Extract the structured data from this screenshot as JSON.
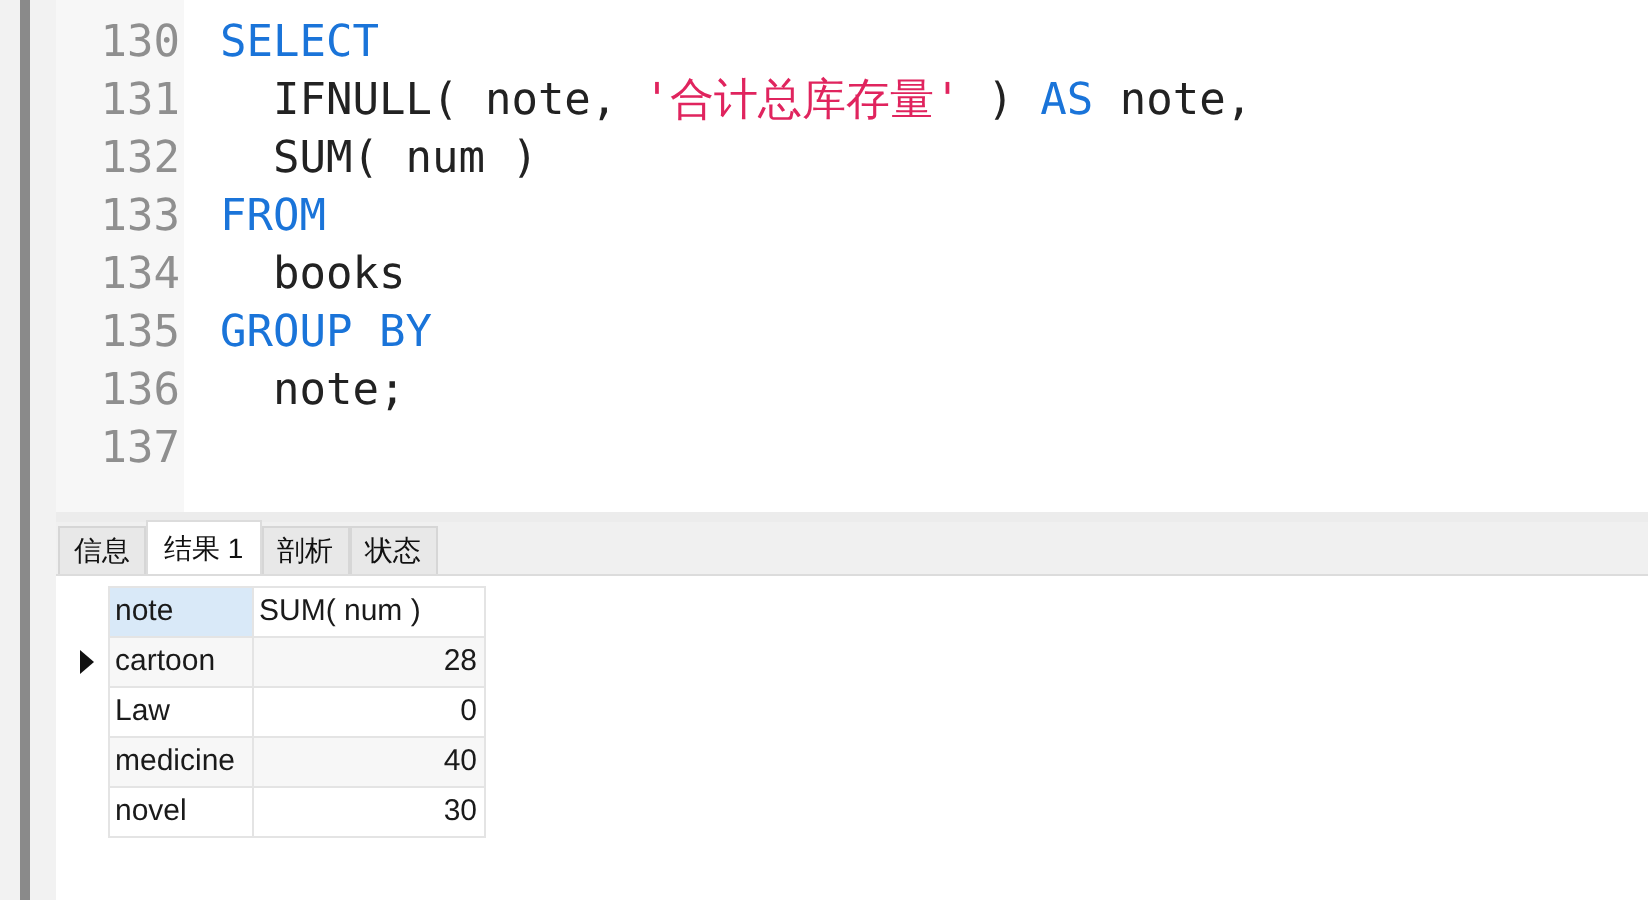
{
  "editor": {
    "lines": [
      {
        "number": "130",
        "tokens": [
          {
            "kind": "keyword",
            "text": "SELECT"
          }
        ]
      },
      {
        "number": "131",
        "tokens": [
          {
            "kind": "plain",
            "text": "  IFNULL( note, "
          },
          {
            "kind": "string",
            "text": "'合计总库存量'"
          },
          {
            "kind": "plain",
            "text": " ) "
          },
          {
            "kind": "keyword",
            "text": "AS"
          },
          {
            "kind": "plain",
            "text": " note,"
          }
        ]
      },
      {
        "number": "132",
        "tokens": [
          {
            "kind": "plain",
            "text": "  SUM( num )"
          }
        ]
      },
      {
        "number": "133",
        "tokens": [
          {
            "kind": "keyword",
            "text": "FROM"
          }
        ]
      },
      {
        "number": "134",
        "tokens": [
          {
            "kind": "plain",
            "text": "  books"
          }
        ]
      },
      {
        "number": "135",
        "tokens": [
          {
            "kind": "keyword",
            "text": "GROUP BY"
          }
        ]
      },
      {
        "number": "136",
        "tokens": [
          {
            "kind": "plain",
            "text": "  note;"
          }
        ]
      },
      {
        "number": "137"
      }
    ]
  },
  "result_tabs": [
    {
      "label": "信息",
      "selected": false
    },
    {
      "label": "结果 1",
      "selected": true
    },
    {
      "label": "剖析",
      "selected": false
    },
    {
      "label": "状态",
      "selected": false
    }
  ],
  "table": {
    "columns": [
      "note",
      "SUM( num )"
    ],
    "rows": [
      {
        "cells": [
          "cartoon",
          "28"
        ],
        "current": true
      },
      {
        "cells": [
          "Law",
          "0"
        ],
        "current": false
      },
      {
        "cells": [
          "medicine",
          "40"
        ],
        "current": false
      },
      {
        "cells": [
          "novel",
          "30"
        ],
        "current": false
      }
    ]
  }
}
